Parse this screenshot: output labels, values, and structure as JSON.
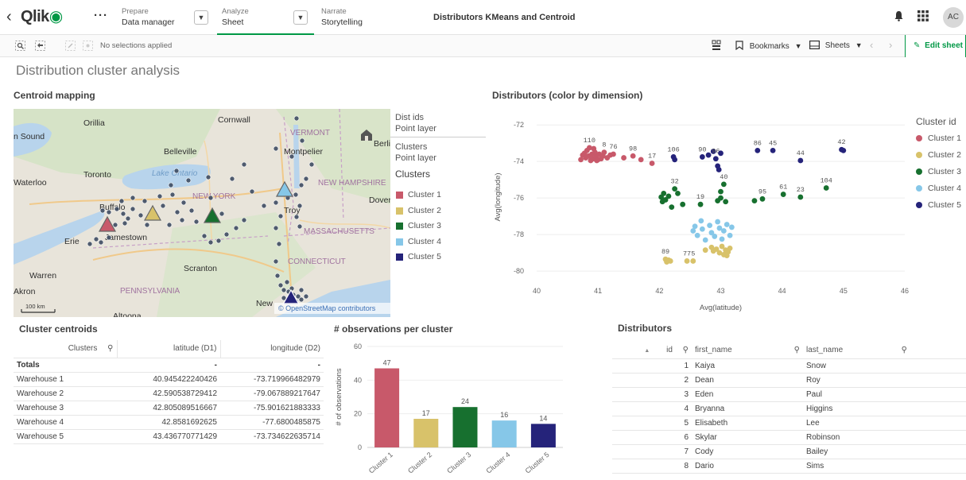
{
  "nav": {
    "logo_text": "Qlik",
    "prepare": {
      "caption": "Prepare",
      "value": "Data manager"
    },
    "analyze": {
      "caption": "Analyze",
      "value": "Sheet"
    },
    "narrate": {
      "caption": "Narrate",
      "value": "Storytelling"
    },
    "app_title": "Distributors KMeans and Centroid",
    "avatar": "AC",
    "icons": [
      "back-chevron-icon",
      "more-icon",
      "bell-icon",
      "grid-icon"
    ]
  },
  "toolbar": {
    "no_selections": "No selections applied",
    "bookmarks": "Bookmarks",
    "sheets": "Sheets",
    "edit_sheet": "Edit sheet"
  },
  "sheet": {
    "title": "Distribution cluster analysis"
  },
  "map": {
    "title": "Centroid mapping",
    "scale": "100 km",
    "attribution": "© OpenStreetMap contributors",
    "place_labels": [
      {
        "text": "Cornwall",
        "dark": true
      },
      {
        "text": "Orillia",
        "dark": true
      },
      {
        "text": "n Sound",
        "dark": true
      },
      {
        "text": "VERMONT",
        "dark": false
      },
      {
        "text": "Berli",
        "dark": true
      },
      {
        "text": "Belleville",
        "dark": true
      },
      {
        "text": "Montpelier",
        "dark": true
      },
      {
        "text": "Toronto",
        "dark": true
      },
      {
        "text": "Lake Ontario",
        "dark": false
      },
      {
        "text": "Waterloo",
        "dark": true
      },
      {
        "text": "NEW HAMPSHIRE",
        "dark": false
      },
      {
        "text": "NEW YORK",
        "dark": false
      },
      {
        "text": "Dover",
        "dark": true
      },
      {
        "text": "Buffalo",
        "dark": true
      },
      {
        "text": "Troy",
        "dark": true
      },
      {
        "text": "Jamestown",
        "dark": true
      },
      {
        "text": "Erie",
        "dark": true
      },
      {
        "text": "MASSACHUSETTS",
        "dark": false
      },
      {
        "text": "Scranton",
        "dark": true
      },
      {
        "text": "CONNECTICUT",
        "dark": false
      },
      {
        "text": "Warren",
        "dark": true
      },
      {
        "text": "PENNSYLVANIA",
        "dark": false
      },
      {
        "text": "Akron",
        "dark": true
      },
      {
        "text": "New",
        "dark": true
      },
      {
        "text": "Altoona",
        "dark": true
      }
    ],
    "legend": {
      "layer1_title": "Dist ids",
      "layer1_sub": "Point layer",
      "layer2_title": "Clusters",
      "layer2_sub": "Point layer",
      "heading": "Clusters",
      "items": [
        {
          "label": "Cluster 1",
          "color": "#c8596a"
        },
        {
          "label": "Cluster 2",
          "color": "#d8c26a"
        },
        {
          "label": "Cluster 3",
          "color": "#17702f"
        },
        {
          "label": "Cluster 4",
          "color": "#86c7e8"
        },
        {
          "label": "Cluster 5",
          "color": "#25237a"
        }
      ]
    }
  },
  "chart_data": [
    {
      "type": "scatter",
      "title": "Distributors (color by dimension)",
      "xlabel": "Avg(latitude)",
      "ylabel": "Avg(longitude)",
      "xlim": [
        40,
        46
      ],
      "ylim": [
        -80.3,
        -71.6
      ],
      "xticks": [
        40,
        41,
        42,
        43,
        44,
        45,
        46
      ],
      "yticks": [
        -72,
        -74,
        -76,
        -78,
        -80
      ],
      "legend_title": "Cluster id",
      "grid": true,
      "legend_position": "right",
      "series": [
        {
          "name": "Cluster 1",
          "color": "#c8596a",
          "points": [
            {
              "x": 40.72,
              "y": -73.9
            },
            {
              "x": 40.75,
              "y": -73.65
            },
            {
              "x": 40.78,
              "y": -73.55
            },
            {
              "x": 40.8,
              "y": -73.8
            },
            {
              "x": 40.82,
              "y": -73.4
            },
            {
              "x": 40.85,
              "y": -73.7
            },
            {
              "x": 40.86,
              "y": -73.25,
              "label": "110"
            },
            {
              "x": 40.88,
              "y": -73.95
            },
            {
              "x": 40.9,
              "y": -73.6
            },
            {
              "x": 40.92,
              "y": -73.85
            },
            {
              "x": 40.95,
              "y": -73.5
            },
            {
              "x": 40.97,
              "y": -73.75
            },
            {
              "x": 41.0,
              "y": -73.9
            },
            {
              "x": 41.02,
              "y": -73.6
            },
            {
              "x": 41.05,
              "y": -73.85
            },
            {
              "x": 41.08,
              "y": -73.7
            },
            {
              "x": 41.1,
              "y": -73.5,
              "label": "8"
            },
            {
              "x": 41.15,
              "y": -73.8
            },
            {
              "x": 41.2,
              "y": -73.65
            },
            {
              "x": 41.25,
              "y": -73.6,
              "label": "76"
            },
            {
              "x": 41.42,
              "y": -73.8
            },
            {
              "x": 41.57,
              "y": -73.7,
              "label": "98"
            },
            {
              "x": 41.7,
              "y": -73.9
            },
            {
              "x": 41.88,
              "y": -74.1,
              "label": "17"
            },
            {
              "x": 40.93,
              "y": -73.3
            },
            {
              "x": 40.98,
              "y": -73.95
            }
          ]
        },
        {
          "name": "Cluster 2",
          "color": "#d8c26a",
          "points": [
            {
              "x": 42.1,
              "y": -79.35,
              "label": "89"
            },
            {
              "x": 42.12,
              "y": -79.5
            },
            {
              "x": 42.15,
              "y": -79.4
            },
            {
              "x": 42.18,
              "y": -79.45
            },
            {
              "x": 42.45,
              "y": -79.45,
              "label": "77"
            },
            {
              "x": 42.55,
              "y": -79.45,
              "label": "5"
            },
            {
              "x": 42.75,
              "y": -78.85
            },
            {
              "x": 42.85,
              "y": -78.7
            },
            {
              "x": 42.93,
              "y": -78.8
            },
            {
              "x": 42.98,
              "y": -79.0
            },
            {
              "x": 43.05,
              "y": -79.1
            },
            {
              "x": 43.12,
              "y": -78.95
            },
            {
              "x": 43.15,
              "y": -78.75
            },
            {
              "x": 43.1,
              "y": -79.15
            },
            {
              "x": 42.88,
              "y": -78.9
            },
            {
              "x": 43.02,
              "y": -78.65
            },
            {
              "x": 43.08,
              "y": -78.85
            }
          ]
        },
        {
          "name": "Cluster 3",
          "color": "#17702f",
          "points": [
            {
              "x": 42.03,
              "y": -75.95
            },
            {
              "x": 42.05,
              "y": -76.2
            },
            {
              "x": 42.07,
              "y": -75.75
            },
            {
              "x": 42.1,
              "y": -76.1
            },
            {
              "x": 42.15,
              "y": -75.9
            },
            {
              "x": 42.2,
              "y": -76.5
            },
            {
              "x": 42.25,
              "y": -75.5,
              "label": "32"
            },
            {
              "x": 42.3,
              "y": -75.75
            },
            {
              "x": 42.38,
              "y": -76.35
            },
            {
              "x": 42.67,
              "y": -76.35,
              "label": "19"
            },
            {
              "x": 42.95,
              "y": -76.15
            },
            {
              "x": 43.0,
              "y": -76.0
            },
            {
              "x": 43.05,
              "y": -75.25,
              "label": "40"
            },
            {
              "x": 43.08,
              "y": -76.2
            },
            {
              "x": 43.0,
              "y": -75.65
            },
            {
              "x": 43.55,
              "y": -76.15
            },
            {
              "x": 43.68,
              "y": -76.05,
              "label": "95"
            },
            {
              "x": 44.02,
              "y": -75.8,
              "label": "61"
            },
            {
              "x": 44.3,
              "y": -75.95,
              "label": "23"
            },
            {
              "x": 44.72,
              "y": -75.45,
              "label": "104"
            }
          ]
        },
        {
          "name": "Cluster 4",
          "color": "#86c7e8",
          "points": [
            {
              "x": 42.55,
              "y": -77.8
            },
            {
              "x": 42.58,
              "y": -77.55
            },
            {
              "x": 42.62,
              "y": -78.05
            },
            {
              "x": 42.68,
              "y": -77.25
            },
            {
              "x": 42.7,
              "y": -77.7
            },
            {
              "x": 42.75,
              "y": -78.3
            },
            {
              "x": 42.82,
              "y": -77.5
            },
            {
              "x": 42.85,
              "y": -77.9
            },
            {
              "x": 42.9,
              "y": -78.1
            },
            {
              "x": 42.95,
              "y": -77.3
            },
            {
              "x": 42.98,
              "y": -77.65
            },
            {
              "x": 43.02,
              "y": -78.25
            },
            {
              "x": 43.05,
              "y": -77.8
            },
            {
              "x": 43.1,
              "y": -77.45
            },
            {
              "x": 43.15,
              "y": -78.05
            },
            {
              "x": 43.18,
              "y": -77.6
            }
          ]
        },
        {
          "name": "Cluster 5",
          "color": "#25237a",
          "points": [
            {
              "x": 42.23,
              "y": -73.75,
              "label": "106"
            },
            {
              "x": 42.25,
              "y": -73.9
            },
            {
              "x": 42.7,
              "y": -73.75,
              "label": "90"
            },
            {
              "x": 42.8,
              "y": -73.65
            },
            {
              "x": 42.88,
              "y": -73.45
            },
            {
              "x": 42.92,
              "y": -73.85,
              "label": "96"
            },
            {
              "x": 42.95,
              "y": -74.25
            },
            {
              "x": 42.97,
              "y": -74.45
            },
            {
              "x": 43.6,
              "y": -73.4,
              "label": "86"
            },
            {
              "x": 43.85,
              "y": -73.4,
              "label": "45"
            },
            {
              "x": 44.3,
              "y": -73.95,
              "label": "44"
            },
            {
              "x": 44.97,
              "y": -73.35,
              "label": "42"
            },
            {
              "x": 45.0,
              "y": -73.4
            },
            {
              "x": 43.0,
              "y": -73.55
            }
          ]
        }
      ]
    },
    {
      "type": "bar",
      "title": "# observations per cluster",
      "xlabel": "",
      "ylabel": "# of observations",
      "categories": [
        "Cluster 1",
        "Cluster 2",
        "Cluster 3",
        "Cluster 4",
        "Cluster 5"
      ],
      "values": [
        47,
        17,
        24,
        16,
        14
      ],
      "colors": [
        "#c8596a",
        "#d8c26a",
        "#17702f",
        "#86c7e8",
        "#25237a"
      ],
      "ylim": [
        0,
        60
      ],
      "yticks": [
        0,
        20,
        40,
        60
      ],
      "grid": true
    }
  ],
  "centroids": {
    "title": "Cluster centroids",
    "headers": [
      "Clusters",
      "latitude (D1)",
      "longitude (D2)"
    ],
    "totals": [
      "Totals",
      "-",
      "-"
    ],
    "rows": [
      [
        "Warehouse 1",
        "40.945422240426",
        "-73.719966482979"
      ],
      [
        "Warehouse 2",
        "42.590538729412",
        "-79.067889217647"
      ],
      [
        "Warehouse 3",
        "42.805089516667",
        "-75.901621883333"
      ],
      [
        "Warehouse 4",
        "42.8581692625",
        "-77.6800485875"
      ],
      [
        "Warehouse 5",
        "43.436770771429",
        "-73.734622635714"
      ]
    ]
  },
  "distributors": {
    "title": "Distributors",
    "headers": [
      "id",
      "first_name",
      "last_name"
    ],
    "rows": [
      [
        "1",
        "Kaiya",
        "Snow"
      ],
      [
        "2",
        "Dean",
        "Roy"
      ],
      [
        "3",
        "Eden",
        "Paul"
      ],
      [
        "4",
        "Bryanna",
        "Higgins"
      ],
      [
        "5",
        "Elisabeth",
        "Lee"
      ],
      [
        "6",
        "Skylar",
        "Robinson"
      ],
      [
        "7",
        "Cody",
        "Bailey"
      ],
      [
        "8",
        "Dario",
        "Sims"
      ]
    ]
  }
}
